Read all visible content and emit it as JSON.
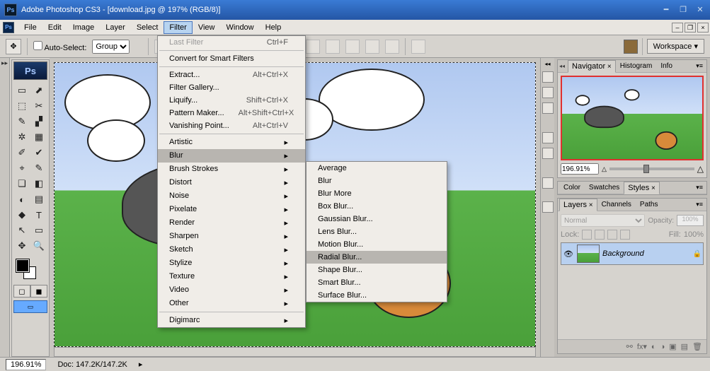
{
  "title": "Adobe Photoshop CS3 - [download.jpg @ 197% (RGB/8)]",
  "menubar": [
    "File",
    "Edit",
    "Image",
    "Layer",
    "Select",
    "Filter",
    "View",
    "Window",
    "Help"
  ],
  "menubar_open_index": 5,
  "optbar": {
    "auto_select": "Auto-Select:",
    "group_value": "Group",
    "workspace": "Workspace ▾"
  },
  "filter_menu": [
    {
      "label": "Last Filter",
      "shortcut": "Ctrl+F",
      "disabled": true
    },
    {
      "sep": true
    },
    {
      "label": "Convert for Smart Filters"
    },
    {
      "sep": true
    },
    {
      "label": "Extract...",
      "shortcut": "Alt+Ctrl+X"
    },
    {
      "label": "Filter Gallery..."
    },
    {
      "label": "Liquify...",
      "shortcut": "Shift+Ctrl+X"
    },
    {
      "label": "Pattern Maker...",
      "shortcut": "Alt+Shift+Ctrl+X"
    },
    {
      "label": "Vanishing Point...",
      "shortcut": "Alt+Ctrl+V"
    },
    {
      "sep": true
    },
    {
      "label": "Artistic",
      "sub": true
    },
    {
      "label": "Blur",
      "sub": true,
      "hl": true
    },
    {
      "label": "Brush Strokes",
      "sub": true
    },
    {
      "label": "Distort",
      "sub": true
    },
    {
      "label": "Noise",
      "sub": true
    },
    {
      "label": "Pixelate",
      "sub": true
    },
    {
      "label": "Render",
      "sub": true
    },
    {
      "label": "Sharpen",
      "sub": true
    },
    {
      "label": "Sketch",
      "sub": true
    },
    {
      "label": "Stylize",
      "sub": true
    },
    {
      "label": "Texture",
      "sub": true
    },
    {
      "label": "Video",
      "sub": true
    },
    {
      "label": "Other",
      "sub": true
    },
    {
      "sep": true
    },
    {
      "label": "Digimarc",
      "sub": true
    }
  ],
  "blur_submenu": [
    "Average",
    "Blur",
    "Blur More",
    "Box Blur...",
    "Gaussian Blur...",
    "Lens Blur...",
    "Motion Blur...",
    "Radial Blur...",
    "Shape Blur...",
    "Smart Blur...",
    "Surface Blur..."
  ],
  "blur_submenu_hl_index": 7,
  "panels": {
    "nav_tabs": [
      "Navigator",
      "Histogram",
      "Info"
    ],
    "nav_zoom": "196.91%",
    "color_tabs": [
      "Color",
      "Swatches",
      "Styles"
    ],
    "layer_tabs": [
      "Layers",
      "Channels",
      "Paths"
    ],
    "blend_mode": "Normal",
    "opacity_label": "Opacity:",
    "opacity_value": "100%",
    "lock_label": "Lock:",
    "fill_label": "Fill:",
    "fill_value": "100%",
    "layer_name": "Background"
  },
  "status": {
    "zoom": "196.91%",
    "doc": "Doc: 147.2K/147.2K"
  },
  "tool_glyphs": [
    [
      "▭",
      "⬈"
    ],
    [
      "⬚",
      "✂"
    ],
    [
      "✎",
      "▞"
    ],
    [
      "✲",
      "▦"
    ],
    [
      "✐",
      "✔"
    ],
    [
      "⌖",
      "✎"
    ],
    [
      "❏",
      "◧"
    ],
    [
      "◐",
      "▤"
    ],
    [
      "◆",
      "T"
    ],
    [
      "↖",
      "▭"
    ],
    [
      "✥",
      "🔍"
    ]
  ]
}
